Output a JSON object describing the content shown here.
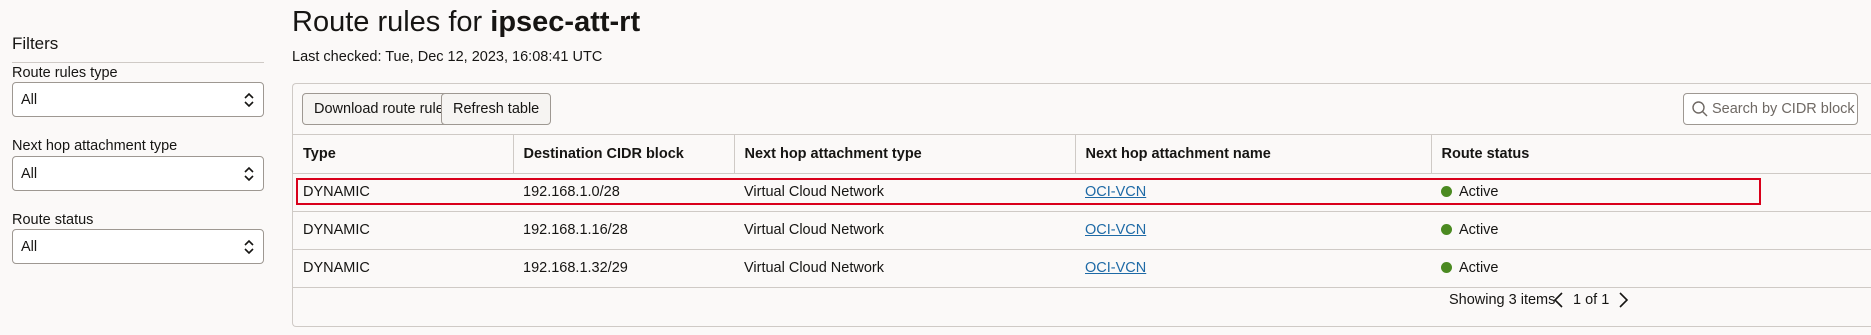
{
  "sidebar": {
    "title": "Filters",
    "filters": [
      {
        "label": "Route rules type",
        "value": "All"
      },
      {
        "label": "Next hop attachment type",
        "value": "All"
      },
      {
        "label": "Route status",
        "value": "All"
      }
    ]
  },
  "header": {
    "title_prefix": "Route rules for ",
    "title_name": "ipsec-att-rt",
    "last_checked": "Last checked: Tue, Dec 12, 2023, 16:08:41 UTC"
  },
  "toolbar": {
    "download_label": "Download route rules",
    "refresh_label": "Refresh table",
    "search_placeholder": "Search by CIDR block"
  },
  "table": {
    "columns": [
      "Type",
      "Destination CIDR block",
      "Next hop attachment type",
      "Next hop attachment name",
      "Route status"
    ],
    "rows": [
      {
        "type": "DYNAMIC",
        "cidr": "192.168.1.0/28",
        "hop_type": "Virtual Cloud Network",
        "hop_name": "OCI-VCN",
        "status": "Active"
      },
      {
        "type": "DYNAMIC",
        "cidr": "192.168.1.16/28",
        "hop_type": "Virtual Cloud Network",
        "hop_name": "OCI-VCN",
        "status": "Active"
      },
      {
        "type": "DYNAMIC",
        "cidr": "192.168.1.32/29",
        "hop_type": "Virtual Cloud Network",
        "hop_name": "OCI-VCN",
        "status": "Active"
      }
    ]
  },
  "footer": {
    "showing": "Showing 3 items",
    "page": "1 of 1"
  },
  "colors": {
    "status_active": "#4b8a21",
    "link": "#1e6aa6",
    "highlight": "#d9001b"
  },
  "icons": {
    "search": "search-icon",
    "select_chevron": "chevron-up-down-icon",
    "prev": "chevron-left-icon",
    "next": "chevron-right-icon",
    "status": "status-dot-icon"
  }
}
